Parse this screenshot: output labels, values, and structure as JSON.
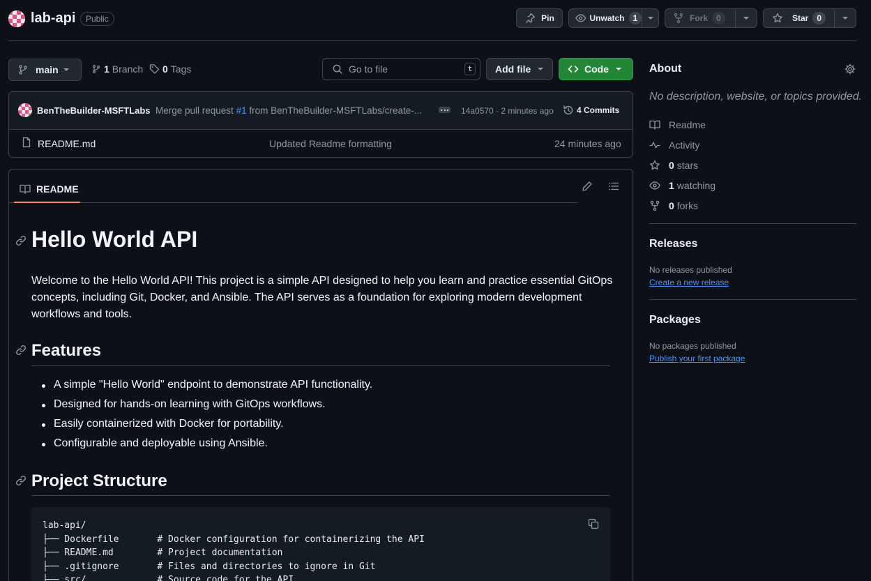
{
  "repo": {
    "name": "lab-api",
    "visibility": "Public"
  },
  "actions": {
    "pin_label": "Pin",
    "unwatch_label": "Unwatch",
    "watch_count": "1",
    "fork_label": "Fork",
    "fork_count": "0",
    "star_label": "Star",
    "star_count": "0"
  },
  "toolbar": {
    "branch": "main",
    "branch_count": "1",
    "branch_label": "Branch",
    "tag_count": "0",
    "tag_label": "Tags",
    "search_placeholder": "Go to file",
    "search_shortcut": "t",
    "add_file_label": "Add file",
    "code_label": "Code"
  },
  "commit": {
    "author": "BenTheBuilder-MSFTLabs",
    "message_prefix": "Merge pull request",
    "pr_link": "#1",
    "message_suffix": "from BenTheBuilder-MSFTLabs/create-...",
    "hash_time": "14a0570 · 2 minutes ago",
    "commits_label": "4 Commits"
  },
  "files": [
    {
      "name": "README.md",
      "message": "Updated Readme formatting",
      "time": "24 minutes ago"
    }
  ],
  "readme": {
    "tab_label": "README",
    "title": "Hello World API",
    "intro": "Welcome to the Hello World API! This project is a simple API designed to help you learn and practice essential GitOps concepts, including Git, Docker, and Ansible. The API serves as a foundation for exploring modern development workflows and tools.",
    "features_heading": "Features",
    "features": [
      "A simple \"Hello World\" endpoint to demonstrate API functionality.",
      "Designed for hands-on learning with GitOps workflows.",
      "Easily containerized with Docker for portability.",
      "Configurable and deployable using Ansible."
    ],
    "structure_heading": "Project Structure",
    "structure_code": "lab-api/\n├── Dockerfile       # Docker configuration for containerizing the API\n├── README.md        # Project documentation\n├── .gitignore       # Files and directories to ignore in Git\n├── src/             # Source code for the API"
  },
  "about": {
    "heading": "About",
    "description": "No description, website, or topics provided.",
    "readme_label": "Readme",
    "activity_label": "Activity",
    "stars_count": "0",
    "stars_label": "stars",
    "watching_count": "1",
    "watching_label": "watching",
    "forks_count": "0",
    "forks_label": "forks"
  },
  "releases": {
    "heading": "Releases",
    "empty_text": "No releases published",
    "create_link": "Create a new release"
  },
  "packages": {
    "heading": "Packages",
    "empty_text": "No packages published",
    "publish_link": "Publish your first package"
  },
  "colors": {
    "background": "#0d1117",
    "border": "#3d444d",
    "accent_green": "#238636",
    "link_blue": "#4493f8",
    "tab_underline": "#f78166"
  }
}
